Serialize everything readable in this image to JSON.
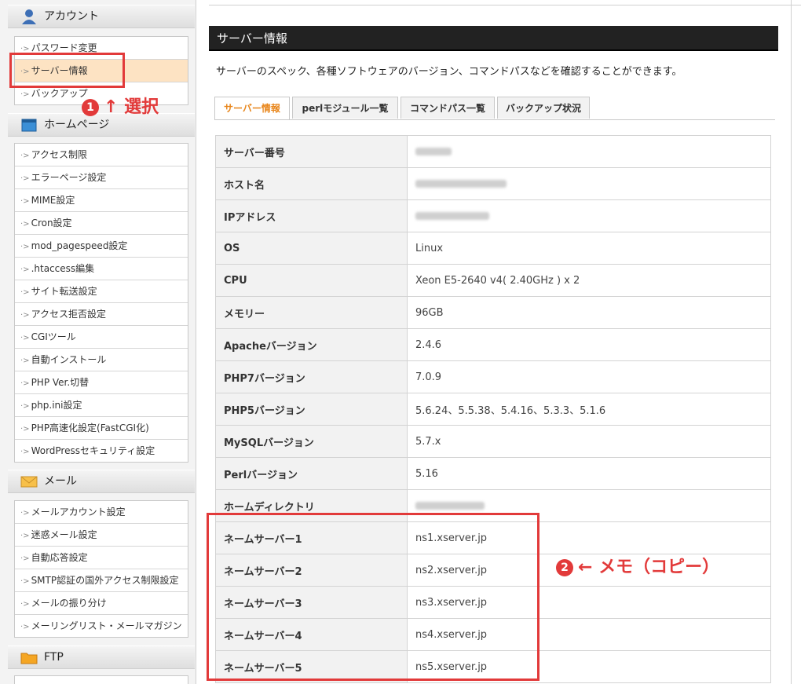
{
  "sidebar": {
    "sections": [
      {
        "label": "アカウント",
        "icon": "user-icon",
        "items": [
          "パスワード変更",
          "サーバー情報",
          "バックアップ"
        ]
      },
      {
        "label": "ホームページ",
        "icon": "window-icon",
        "items": [
          "アクセス制限",
          "エラーページ設定",
          "MIME設定",
          "Cron設定",
          "mod_pagespeed設定",
          ".htaccess編集",
          "サイト転送設定",
          "アクセス拒否設定",
          "CGIツール",
          "自動インストール",
          "PHP Ver.切替",
          "php.ini設定",
          "PHP高速化設定(FastCGI化)",
          "WordPressセキュリティ設定"
        ]
      },
      {
        "label": "メール",
        "icon": "envelope-icon",
        "items": [
          "メールアカウント設定",
          "迷惑メール設定",
          "自動応答設定",
          "SMTP認証の国外アクセス制限設定",
          "メールの振り分け",
          "メーリングリスト・メールマガジン"
        ]
      },
      {
        "label": "FTP",
        "icon": "folder-icon",
        "items": []
      }
    ],
    "active_item": "サーバー情報"
  },
  "main": {
    "title": "サーバー情報",
    "description": "サーバーのスペック、各種ソフトウェアのバージョン、コマンドパスなどを確認することができます。",
    "tabs": [
      "サーバー情報",
      "perlモジュール一覧",
      "コマンドパス一覧",
      "バックアップ状況"
    ],
    "active_tab": "サーバー情報",
    "rows": [
      {
        "label": "サーバー番号",
        "value": "",
        "blurred": true
      },
      {
        "label": "ホスト名",
        "value": "",
        "blurred": true
      },
      {
        "label": "IPアドレス",
        "value": "",
        "blurred": true
      },
      {
        "label": "OS",
        "value": "Linux"
      },
      {
        "label": "CPU",
        "value": "Xeon E5-2640 v4( 2.40GHz ) x 2"
      },
      {
        "label": "メモリー",
        "value": "96GB"
      },
      {
        "label": "Apacheバージョン",
        "value": "2.4.6"
      },
      {
        "label": "PHP7バージョン",
        "value": "7.0.9"
      },
      {
        "label": "PHP5バージョン",
        "value": "5.6.24、5.5.38、5.4.16、5.3.3、5.1.6"
      },
      {
        "label": "MySQLバージョン",
        "value": "5.7.x"
      },
      {
        "label": "Perlバージョン",
        "value": "5.16"
      },
      {
        "label": "ホームディレクトリ",
        "value": "",
        "blurred": true
      },
      {
        "label": "ネームサーバー1",
        "value": "ns1.xserver.jp"
      },
      {
        "label": "ネームサーバー2",
        "value": "ns2.xserver.jp"
      },
      {
        "label": "ネームサーバー3",
        "value": "ns3.xserver.jp"
      },
      {
        "label": "ネームサーバー4",
        "value": "ns4.xserver.jp"
      },
      {
        "label": "ネームサーバー5",
        "value": "ns5.xserver.jp"
      }
    ]
  },
  "annotations": {
    "step1_number": "1",
    "step1_text": "↑ 選択",
    "step2_number": "2",
    "step2_text": "← メモ（コピー）",
    "color": "#e23a3a"
  }
}
